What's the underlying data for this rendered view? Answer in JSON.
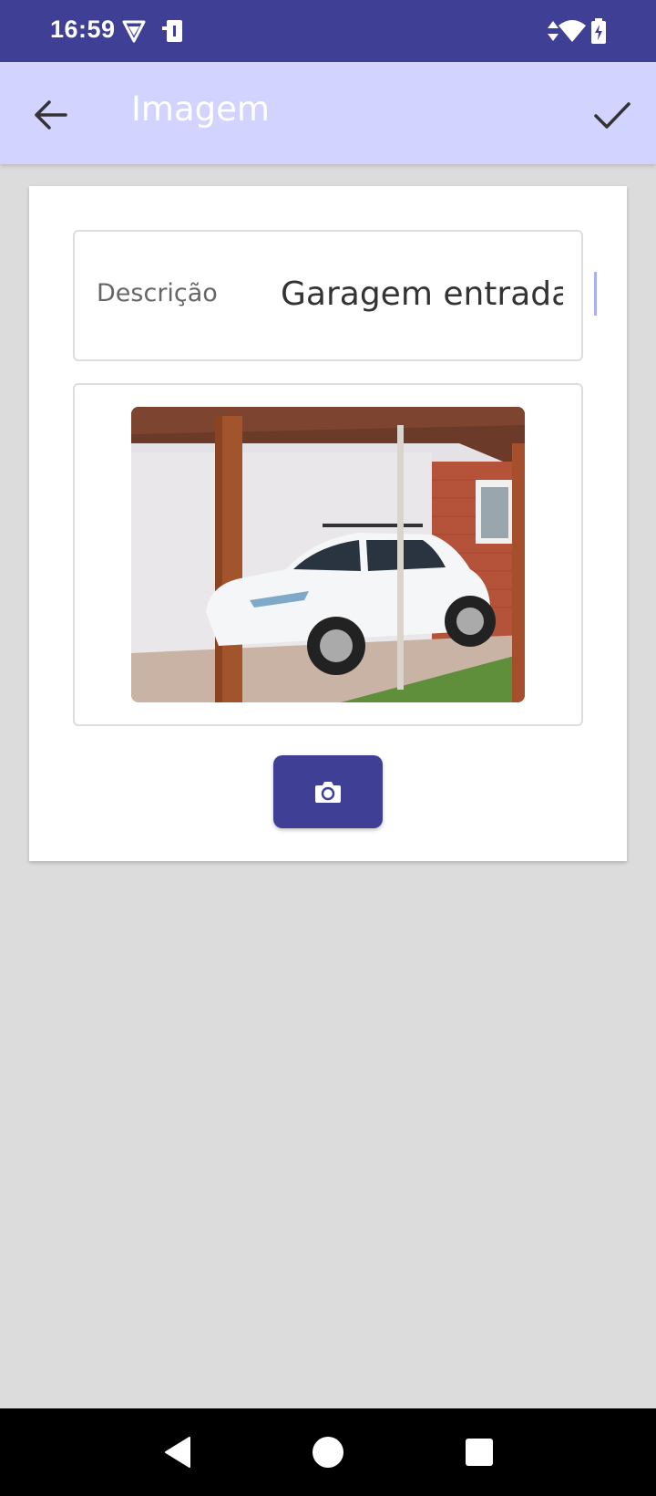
{
  "status_bar": {
    "time": "16:59",
    "icons": [
      "vpn-shield-icon",
      "work-profile-icon",
      "data-transfer-icon",
      "wifi-icon",
      "battery-charging-icon"
    ]
  },
  "app_bar": {
    "title": "Imagem",
    "back_icon": "arrow-back-icon",
    "confirm_icon": "check-icon",
    "background_color": "#d2d3fe"
  },
  "form": {
    "description_label": "Descrição",
    "description_value": "Garagem entrada",
    "image_description": "photo-of-white-suv-in-carport",
    "camera_button_icon": "camera-icon"
  },
  "nav_bar": {
    "buttons": [
      "back-triangle-icon",
      "home-circle-icon",
      "recents-square-icon"
    ]
  },
  "colors": {
    "primary": "#3f3f96",
    "app_bar": "#d2d3fe",
    "background": "#dcdcdc"
  }
}
